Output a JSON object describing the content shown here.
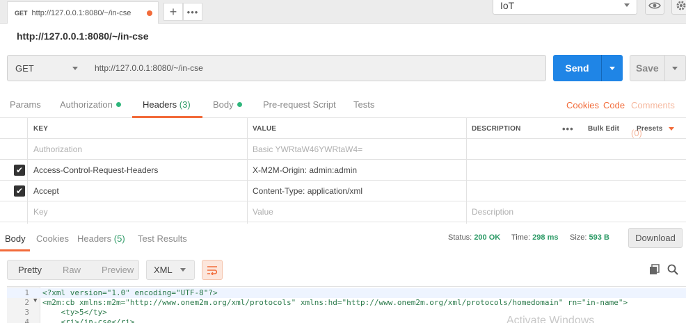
{
  "tab": {
    "method": "GET",
    "title": "http://127.0.0.1:8080/~/in-cse"
  },
  "environment": {
    "name": "IoT"
  },
  "request": {
    "title": "http://127.0.0.1:8080/~/in-cse",
    "method": "GET",
    "url": "http://127.0.0.1:8080/~/in-cse",
    "send_label": "Send",
    "save_label": "Save"
  },
  "request_tabs": {
    "params": "Params",
    "authorization": "Authorization",
    "headers": "Headers",
    "headers_count": "(3)",
    "body": "Body",
    "prerequest": "Pre-request Script",
    "tests": "Tests",
    "cookies": "Cookies",
    "code": "Code",
    "comments": "Comments (0)"
  },
  "headers_table": {
    "col_key": "KEY",
    "col_value": "VALUE",
    "col_description": "DESCRIPTION",
    "bulk_edit": "Bulk Edit",
    "presets": "Presets",
    "rows": [
      {
        "key": "Authorization",
        "value": "Basic YWRtaW46YWRtaW4=",
        "description": "",
        "checked": false,
        "disabled": true
      },
      {
        "key": "Access-Control-Request-Headers",
        "value": "X-M2M-Origin: admin:admin",
        "description": "",
        "checked": true,
        "disabled": false
      },
      {
        "key": "Accept",
        "value": "Content-Type: application/xml",
        "description": "",
        "checked": true,
        "disabled": false
      }
    ],
    "placeholder_key": "Key",
    "placeholder_value": "Value",
    "placeholder_description": "Description"
  },
  "response_tabs": {
    "body": "Body",
    "cookies": "Cookies",
    "headers": "Headers",
    "headers_count": "(5)",
    "test_results": "Test Results"
  },
  "response_status": {
    "status_label": "Status:",
    "status_value": "200 OK",
    "time_label": "Time:",
    "time_value": "298 ms",
    "size_label": "Size:",
    "size_value": "593 B",
    "download": "Download"
  },
  "body_toolbar": {
    "pretty": "Pretty",
    "raw": "Raw",
    "preview": "Preview",
    "format": "XML"
  },
  "code_lines": [
    {
      "n": "1",
      "text": "<?xml version=\"1.0\" encoding=\"UTF-8\"?>"
    },
    {
      "n": "2",
      "text": "<m2m:cb xmlns:m2m=\"http://www.onem2m.org/xml/protocols\" xmlns:hd=\"http://www.onem2m.org/xml/protocols/homedomain\" rn=\"in-name\">"
    },
    {
      "n": "3",
      "text": "    <ty>5</ty>"
    },
    {
      "n": "4",
      "text": "    <ri>/in-cse</ri>"
    }
  ],
  "watermark": "Activate Windows"
}
